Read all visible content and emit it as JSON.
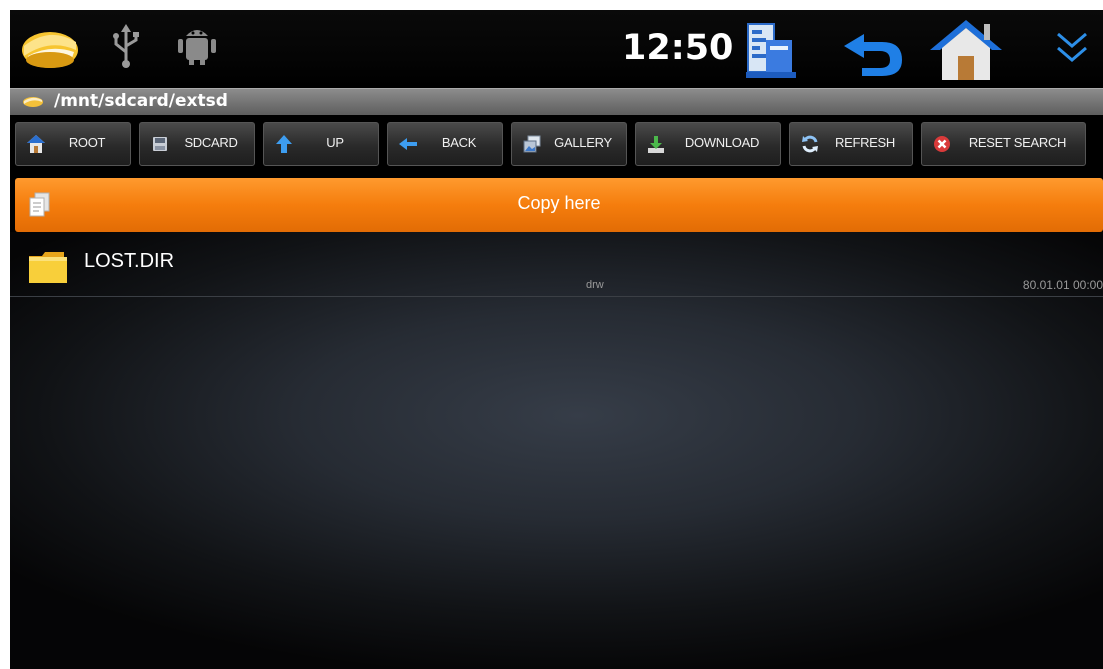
{
  "status_bar": {
    "clock": "12:50",
    "icons": [
      "file-manager-app-icon",
      "usb-icon",
      "android-debug-icon",
      "task-manager-icon",
      "back-arrow-icon",
      "home-icon",
      "expand-chevron-icon"
    ]
  },
  "path_bar": {
    "path": "/mnt/sdcard/extsd"
  },
  "toolbar": {
    "buttons": [
      {
        "label": "ROOT",
        "icon": "home-icon"
      },
      {
        "label": "SDCARD",
        "icon": "sdcard-icon"
      },
      {
        "label": "UP",
        "icon": "up-arrow-icon"
      },
      {
        "label": "BACK",
        "icon": "back-arrow-icon"
      },
      {
        "label": "GALLERY",
        "icon": "gallery-icon"
      },
      {
        "label": "DOWNLOAD",
        "icon": "download-icon"
      },
      {
        "label": "REFRESH",
        "icon": "refresh-icon"
      },
      {
        "label": "RESET SEARCH",
        "icon": "reset-search-icon"
      }
    ]
  },
  "copy_bar": {
    "label": "Copy here"
  },
  "files": [
    {
      "name": "LOST.DIR",
      "permissions": "drw",
      "modified": "80.01.01 00:00",
      "icon": "folder-icon"
    }
  ],
  "colors": {
    "accent_orange": "#f57d0d",
    "background": "#000000",
    "path_bar": "#767676"
  }
}
